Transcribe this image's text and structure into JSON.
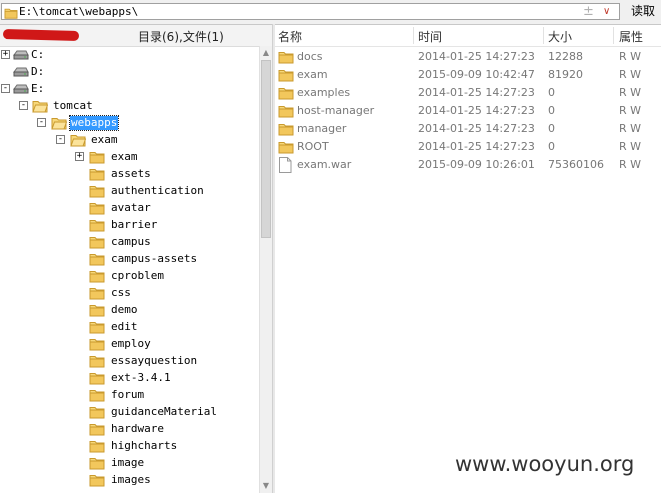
{
  "address": {
    "path": "E:\\tomcat\\webapps\\",
    "add_glyph": "±",
    "dropdown_glyph": "∨",
    "read_label": "读取"
  },
  "left_header": {
    "count_label": "目录(6),文件(1)"
  },
  "drives": [
    {
      "label": "C:",
      "expander": "+"
    },
    {
      "label": "D:",
      "expander": ""
    },
    {
      "label": "E:",
      "expander": "-"
    }
  ],
  "tree": {
    "tomcat": "tomcat",
    "webapps": "webapps",
    "exam_root": "exam",
    "children": [
      "exam",
      "assets",
      "authentication",
      "avatar",
      "barrier",
      "campus",
      "campus-assets",
      "cproblem",
      "css",
      "demo",
      "edit",
      "employ",
      "essayquestion",
      "ext-3.4.1",
      "forum",
      "guidanceMaterial",
      "hardware",
      "highcharts",
      "image",
      "images"
    ]
  },
  "columns": {
    "name": "名称",
    "time": "时间",
    "size": "大小",
    "attr": "属性"
  },
  "files": [
    {
      "name": "docs",
      "time": "2014-01-25 14:27:23",
      "size": "12288",
      "attr": "R W",
      "icon": "folder-icon"
    },
    {
      "name": "exam",
      "time": "2015-09-09 10:42:47",
      "size": "81920",
      "attr": "R W",
      "icon": "folder-icon"
    },
    {
      "name": "examples",
      "time": "2014-01-25 14:27:23",
      "size": "0",
      "attr": "R W",
      "icon": "folder-icon"
    },
    {
      "name": "host-manager",
      "time": "2014-01-25 14:27:23",
      "size": "0",
      "attr": "R W",
      "icon": "folder-icon"
    },
    {
      "name": "manager",
      "time": "2014-01-25 14:27:23",
      "size": "0",
      "attr": "R W",
      "icon": "folder-icon"
    },
    {
      "name": "ROOT",
      "time": "2014-01-25 14:27:23",
      "size": "0",
      "attr": "R W",
      "icon": "folder-icon"
    },
    {
      "name": "exam.war",
      "time": "2015-09-09 10:26:01",
      "size": "75360106",
      "attr": "R W",
      "icon": "file-icon"
    }
  ],
  "watermark": "www.wooyun.org",
  "colors": {
    "folder": "#f2c75c",
    "selection": "#3399ff",
    "redact": "#d01818"
  }
}
